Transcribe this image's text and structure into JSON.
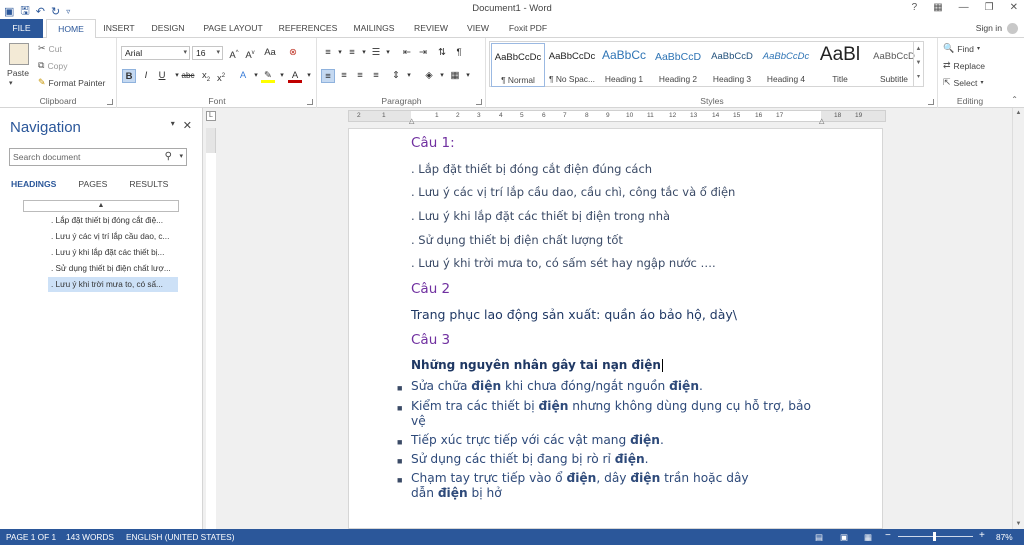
{
  "window": {
    "title": "Document1 - Word",
    "help_icon": "?",
    "controls": [
      "ribbon-display-icon",
      "minimize-icon",
      "restore-icon",
      "close-icon"
    ]
  },
  "qat": {
    "icons": [
      "word-logo-icon",
      "save-icon",
      "undo-icon",
      "redo-icon",
      "customize-icon"
    ]
  },
  "tabs": [
    "FILE",
    "HOME",
    "INSERT",
    "DESIGN",
    "PAGE LAYOUT",
    "REFERENCES",
    "MAILINGS",
    "REVIEW",
    "VIEW",
    "Foxit PDF"
  ],
  "active_tab": "HOME",
  "signin": "Sign in",
  "clipboard": {
    "paste": "Paste",
    "cut": "Cut",
    "copy": "Copy",
    "format_painter": "Format Painter",
    "label": "Clipboard"
  },
  "font": {
    "name": "Arial",
    "size": "16",
    "label": "Font"
  },
  "paragraph": {
    "label": "Paragraph"
  },
  "styles": {
    "label": "Styles",
    "items": [
      {
        "sample": "AaBbCcDc",
        "name": "¶ Normal"
      },
      {
        "sample": "AaBbCcDc",
        "name": "¶ No Spac..."
      },
      {
        "sample": "AaBbCc",
        "name": "Heading 1"
      },
      {
        "sample": "AaBbCcD",
        "name": "Heading 2"
      },
      {
        "sample": "AaBbCcD",
        "name": "Heading 3"
      },
      {
        "sample": "AaBbCcDc",
        "name": "Heading 4"
      },
      {
        "sample": "AaBl",
        "name": "Title"
      },
      {
        "sample": "AaBbCcD",
        "name": "Subtitle"
      }
    ]
  },
  "editing": {
    "find": "Find",
    "replace": "Replace",
    "select": "Select",
    "label": "Editing"
  },
  "navigation": {
    "title": "Navigation",
    "search_placeholder": "Search document",
    "tabs": [
      "HEADINGS",
      "PAGES",
      "RESULTS"
    ],
    "headings": [
      ". Lắp đặt thiết bị đóng cắt điệ...",
      ". Lưu ý các vị trí lắp cầu dao, c...",
      ". Lưu ý khi lắp đặt các thiết bị...",
      ". Sử dụng thiết bị điện chất lượ...",
      ". Lưu ý khi trời mưa to, có sấ..."
    ]
  },
  "ruler": {
    "numbers": [
      "2",
      "1",
      "1",
      "2",
      "3",
      "4",
      "5",
      "6",
      "7",
      "8",
      "9",
      "10",
      "11",
      "12",
      "13",
      "14",
      "15",
      "16",
      "17",
      "18",
      "19"
    ]
  },
  "document": {
    "cau1": "Câu 1:",
    "cau1_items": [
      ". Lắp đặt thiết bị đóng cắt điện đúng cách",
      ". Lưu ý các vị trí lắp cầu dao, cầu chì, công tắc và ổ điện",
      ". Lưu ý khi lắp đặt các thiết bị điện trong nhà",
      ". Sử dụng thiết bị điện chất lượng tốt",
      ". Lưu ý khi trời mưa to, có sấm sét hay ngập nước …."
    ],
    "cau2": "Câu 2",
    "cau2_text": "Trang phục lao động sản xuất: quần áo bảo hộ, dày\\",
    "cau3": "Câu 3",
    "cau3_title": "Những nguyên nhân gây tai nạn điện",
    "bullets": {
      "b1a": "Sửa chữa ",
      "b1b": "điện",
      "b1c": " khi chưa đóng/ngắt nguồn ",
      "b1d": "điện",
      "b1e": ".",
      "b2a": "Kiểm tra các thiết bị ",
      "b2b": "điện",
      "b2c": " nhưng không dùng dụng cụ hỗ trợ, bảo",
      "b2d": "vệ",
      "b3a": "Tiếp xúc trực tiếp với các vật mang ",
      "b3b": "điện",
      "b3c": ".",
      "b4a": "Sử dụng các thiết bị đang bị rò rỉ ",
      "b4b": "điện",
      "b4c": ".",
      "b5a": "Chạm tay trực tiếp vào ổ ",
      "b5b": "điện",
      "b5c": ", dây ",
      "b5d": "điện",
      "b5e": " trần hoặc dây",
      "b5f": "dẫn ",
      "b5g": "điện",
      "b5h": " bị hở"
    }
  },
  "status": {
    "page": "PAGE 1 OF 1",
    "words": "143 WORDS",
    "language": "ENGLISH (UNITED STATES)",
    "zoom": "87%",
    "zoom_minus": "−",
    "zoom_plus": "+"
  },
  "colors": {
    "accent": "#2b579a",
    "heading": "#7030a0",
    "body": "#1f3864"
  }
}
